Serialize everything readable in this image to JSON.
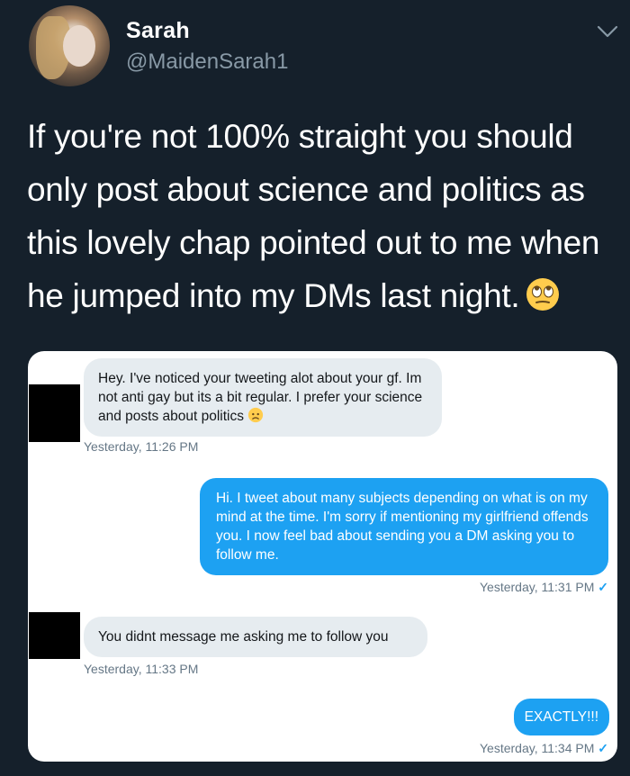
{
  "tweet": {
    "display_name": "Sarah",
    "handle": "@MaidenSarah1",
    "text": "If you're not 100% straight you should only post about science and politics as this lovely chap pointed out to me when he jumped into my DMs last night.",
    "emoji": "eye-roll-emoji"
  },
  "dm": {
    "messages": [
      {
        "direction": "incoming",
        "text": "Hey. I've noticed your tweeting alot about your gf. Im not anti gay but its a bit regular. I prefer your science and posts about politics",
        "emoji": "worried-face-emoji",
        "timestamp": "Yesterday, 11:26 PM"
      },
      {
        "direction": "outgoing",
        "text": "Hi. I tweet about many subjects depending on what is on my mind at the time. I'm sorry if mentioning my girlfriend offends you. I now feel bad about sending you a DM asking you to follow me.",
        "timestamp": "Yesterday, 11:31 PM",
        "read_mark": "✓"
      },
      {
        "direction": "incoming",
        "text": "You didnt message me asking me to follow you",
        "timestamp": "Yesterday, 11:33 PM"
      },
      {
        "direction": "outgoing",
        "text": "EXACTLY!!!",
        "timestamp": "Yesterday, 11:34 PM",
        "read_mark": "✓"
      }
    ]
  },
  "colors": {
    "background": "#15202b",
    "accent_blue": "#1da1f2",
    "incoming_bubble": "#e6ecf0",
    "muted_text": "#8899a6"
  }
}
